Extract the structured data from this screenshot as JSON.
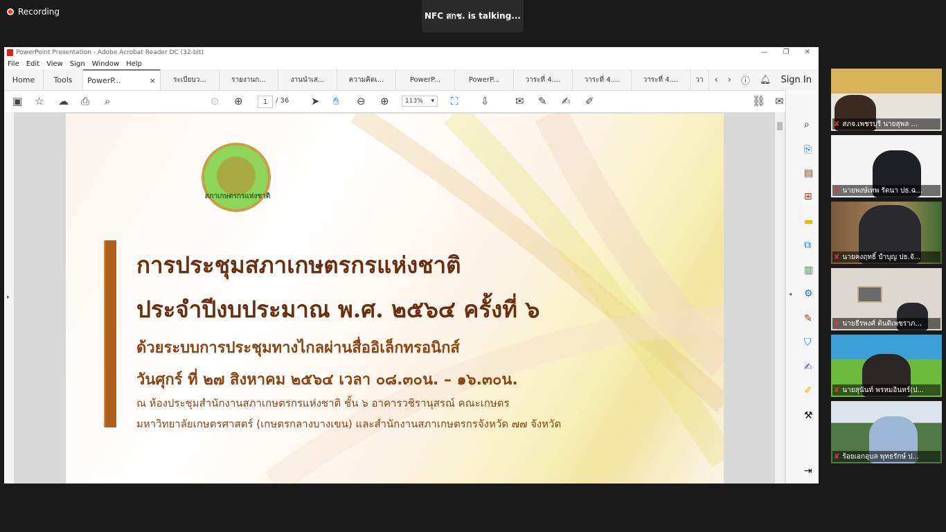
{
  "zoom": {
    "recording_label": "Recording",
    "talking_label": "NFC สกช. is  talking..."
  },
  "acrobat": {
    "window_title": "PowerPoint Presentation - Adobe Acrobat Reader DC (32-bit)",
    "menu": [
      "File",
      "Edit",
      "View",
      "Sign",
      "Window",
      "Help"
    ],
    "tabs": {
      "home": "Home",
      "tools": "Tools",
      "active": "PowerP...",
      "docs": [
        "ระเบียบว...",
        "รายงานก...",
        "งานนำเส...",
        "ความคิดเ...",
        "PowerP...",
        "PowerP...",
        "วาระที่ 4....",
        "วาระที่ 4....",
        "วาระที่ 4....",
        "วา"
      ]
    },
    "sign_in": "Sign In",
    "page_current": "1",
    "page_total": "/ 36",
    "zoom_level": "113%"
  },
  "slide": {
    "logo_text": "สภาเกษตรกรแห่งชาติ",
    "title_line1": "การประชุมสภาเกษตรกรแห่งชาติ",
    "title_line2": "ประจำปีงบประมาณ พ.ศ. ๒๕๖๔ ครั้งที่ ๖",
    "line3": "ด้วยระบบการประชุมทางไกลผ่านสื่ออิเล็กทรอนิกส์",
    "line4": "วันศุกร์ ที่ ๒๗ สิงหาคม ๒๕๖๔ เวลา ๐๘.๓๐น. – ๑๖.๓๐น.",
    "line5": "ณ ห้องประชุมสำนักงานสภาเกษตรกรแห่งชาติ ชั้น ๖ อาคารวชิรานุสรณ์ คณะเกษตร",
    "line6": "มหาวิทยาลัยเกษตรศาสตร์ (เกษตรกลางบางเขน) และสำนักงานสภาเกษตรกรจังหวัด ๗๗ จังหวัด"
  },
  "participants": [
    {
      "name": "สภจ.เพชรบุรี นายสุพล ..."
    },
    {
      "name": "นายพงษ์เทพ รัตนา ปธ.ฉ..."
    },
    {
      "name": "นายคงฤทธิ์ ปำบุญ ปธ.จั..."
    },
    {
      "name": "นายธีรพงศ์ ต้นติเพชราภ..."
    },
    {
      "name": "นายสุนันท์ พรหมอินทร์(ป..."
    },
    {
      "name": "ร้อยเอกอุบล พุทธรักษ์ ป..."
    }
  ]
}
